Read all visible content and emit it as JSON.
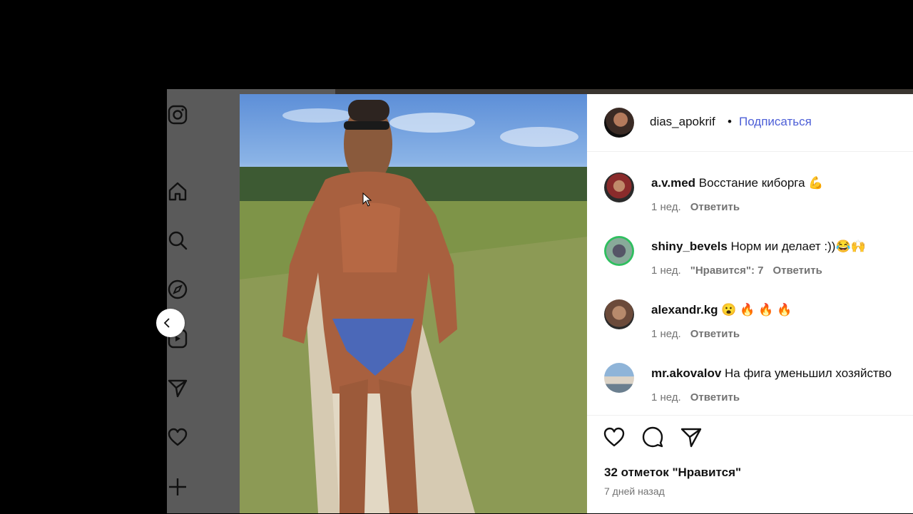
{
  "post": {
    "username": "dias_apokrif",
    "separator": "•",
    "follow_label": "Подписаться",
    "likes_text": "32 отметок \"Нравится\"",
    "posted_ago": "7 дней назад"
  },
  "comments": [
    {
      "user": "a.v.med",
      "text": "Восстание киборга 💪",
      "time": "1 нед.",
      "likes": "",
      "reply": "Ответить"
    },
    {
      "user": "shiny_bevels",
      "text": "Норм ии делает :))😂🙌",
      "time": "1 нед.",
      "likes": "\"Нравится\": 7",
      "reply": "Ответить"
    },
    {
      "user": "alexandr.kg",
      "text": "😮 🔥 🔥 🔥",
      "time": "1 нед.",
      "likes": "",
      "reply": "Ответить"
    },
    {
      "user": "mr.akovalov",
      "text": "На фига уменьшил хозяйство",
      "time": "1 нед.",
      "likes": "",
      "reply": "Ответить"
    }
  ],
  "sidebar": {
    "icons": [
      "instagram-icon",
      "home-icon",
      "search-icon",
      "explore-icon",
      "reels-icon",
      "messages-icon",
      "notifications-icon",
      "create-icon"
    ]
  },
  "actions": {
    "icons": [
      "heart-icon",
      "comment-icon",
      "share-icon"
    ]
  },
  "colors": {
    "follow": "#4d5fd7",
    "meta": "#737373",
    "backdrop": "#5a5a5a"
  }
}
